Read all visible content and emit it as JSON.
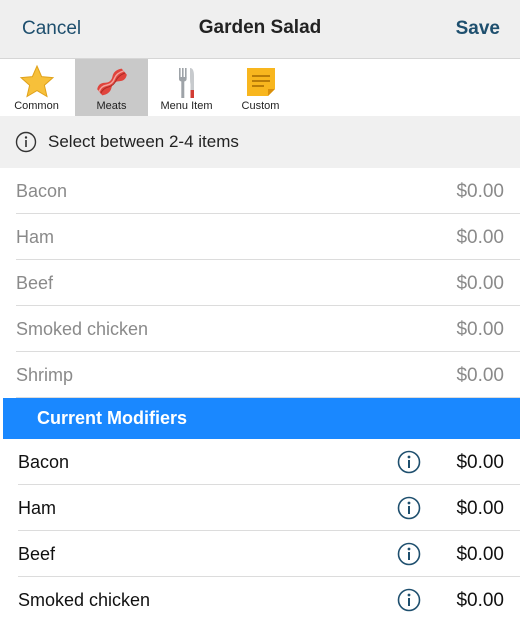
{
  "header": {
    "cancel_label": "Cancel",
    "title": "Garden Salad",
    "save_label": "Save"
  },
  "tabs": [
    {
      "label": "Common",
      "icon": "star-icon",
      "selected": false
    },
    {
      "label": "Meats",
      "icon": "bacon-icon",
      "selected": true
    },
    {
      "label": "Menu Item",
      "icon": "utensils-icon",
      "selected": false
    },
    {
      "label": "Custom",
      "icon": "sticky-note-icon",
      "selected": false
    }
  ],
  "info_message": "Select between 2-4 items",
  "available_items": [
    {
      "name": "Bacon",
      "price": "$0.00"
    },
    {
      "name": "Ham",
      "price": "$0.00"
    },
    {
      "name": "Beef",
      "price": "$0.00"
    },
    {
      "name": "Smoked chicken",
      "price": "$0.00"
    },
    {
      "name": "Shrimp",
      "price": "$0.00"
    }
  ],
  "current_header": "Current Modifiers",
  "current_items": [
    {
      "name": "Bacon",
      "price": "$0.00"
    },
    {
      "name": "Ham",
      "price": "$0.00"
    },
    {
      "name": "Beef",
      "price": "$0.00"
    },
    {
      "name": "Smoked chicken",
      "price": "$0.00"
    }
  ],
  "colors": {
    "accent_blue": "#1a88ff",
    "header_text": "#1e4f6e",
    "selected_tab": "#c9c9c9"
  }
}
